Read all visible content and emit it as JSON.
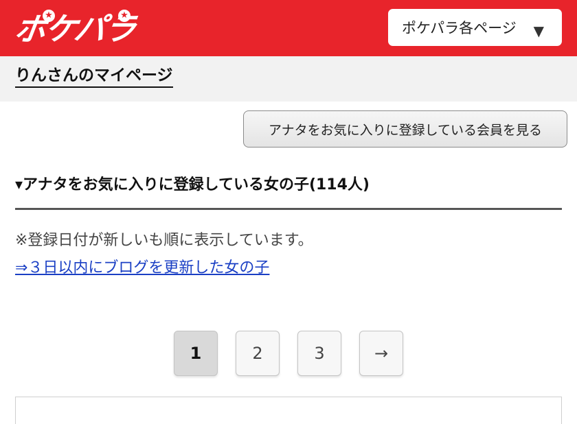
{
  "header": {
    "logo_text": "ポケパラ",
    "menu_label": "ポケパラ各ページ",
    "menu_caret": "▼"
  },
  "subbar": {
    "mypage_label": "りんさんのマイページ"
  },
  "members_button_label": "アナタをお気に入りに登録している会員を見る",
  "section": {
    "title": "▾アナタをお気に入りに登録している女の子(114人)",
    "note": "※登録日付が新しいも順に表示しています。",
    "blog_link": "⇒３日以内にブログを更新した女の子"
  },
  "pagination": {
    "pages": [
      "1",
      "2",
      "3"
    ],
    "current": "1",
    "next": "→"
  },
  "colors": {
    "brand_red": "#e8242b",
    "link_blue": "#1a3fc4"
  }
}
